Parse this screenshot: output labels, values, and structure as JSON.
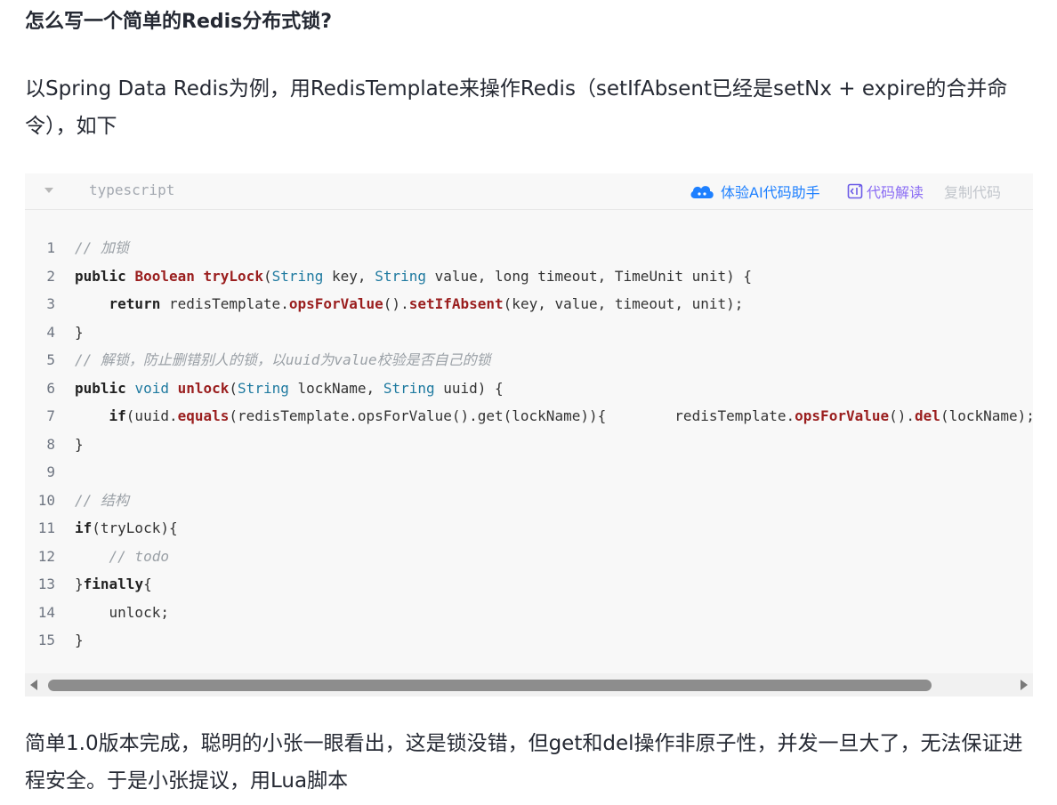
{
  "article": {
    "heading": "怎么写一个简单的Redis分布式锁?",
    "intro": "以Spring Data Redis为例，用RedisTemplate来操作Redis（setIfAbsent已经是setNx + expire的合并命令），如下",
    "followup": "简单1.0版本完成，聪明的小张一眼看出，这是锁没错，但get和del操作非原子性，并发一旦大了，无法保证进程安全。于是小张提议，用Lua脚本"
  },
  "code_block": {
    "language": "typescript",
    "ai_assistant_label": "体验AI代码助手",
    "explain_label": "代码解读",
    "copy_label": "复制代码",
    "scroll_position": 0.0,
    "lines": [
      {
        "n": "1",
        "segments": [
          {
            "t": "// 加锁",
            "c": "cm"
          }
        ]
      },
      {
        "n": "2",
        "segments": [
          {
            "t": "public",
            "c": "kw"
          },
          {
            "t": " "
          },
          {
            "t": "Boolean",
            "c": "cl"
          },
          {
            "t": " "
          },
          {
            "t": "tryLock",
            "c": "fn"
          },
          {
            "t": "("
          },
          {
            "t": "String",
            "c": "ty"
          },
          {
            "t": " key, "
          },
          {
            "t": "String",
            "c": "ty"
          },
          {
            "t": " value, long timeout, TimeUnit unit) {"
          }
        ]
      },
      {
        "n": "3",
        "segments": [
          {
            "t": "    "
          },
          {
            "t": "return",
            "c": "kw"
          },
          {
            "t": " redisTemplate."
          },
          {
            "t": "opsForValue",
            "c": "fn"
          },
          {
            "t": "()."
          },
          {
            "t": "setIfAbsent",
            "c": "fn"
          },
          {
            "t": "(key, value, timeout, unit);"
          }
        ]
      },
      {
        "n": "4",
        "segments": [
          {
            "t": "}"
          }
        ]
      },
      {
        "n": "5",
        "segments": [
          {
            "t": "// 解锁，防止删错别人的锁，以uuid为value校验是否自己的锁",
            "c": "cm"
          }
        ]
      },
      {
        "n": "6",
        "segments": [
          {
            "t": "public",
            "c": "kw"
          },
          {
            "t": " "
          },
          {
            "t": "void",
            "c": "ty"
          },
          {
            "t": " "
          },
          {
            "t": "unlock",
            "c": "fn"
          },
          {
            "t": "("
          },
          {
            "t": "String",
            "c": "ty"
          },
          {
            "t": " lockName, "
          },
          {
            "t": "String",
            "c": "ty"
          },
          {
            "t": " uuid) {"
          }
        ]
      },
      {
        "n": "7",
        "segments": [
          {
            "t": "    "
          },
          {
            "t": "if",
            "c": "kw"
          },
          {
            "t": "(uuid."
          },
          {
            "t": "equals",
            "c": "fn"
          },
          {
            "t": "(redisTemplate.opsForValue().get(lockName)){        redisTemplate."
          },
          {
            "t": "opsForValue",
            "c": "fn"
          },
          {
            "t": "()."
          },
          {
            "t": "del",
            "c": "fn"
          },
          {
            "t": "(lockName); }"
          }
        ]
      },
      {
        "n": "8",
        "segments": [
          {
            "t": "}"
          }
        ]
      },
      {
        "n": "9",
        "segments": [
          {
            "t": ""
          }
        ]
      },
      {
        "n": "10",
        "segments": [
          {
            "t": "// 结构",
            "c": "cm"
          }
        ]
      },
      {
        "n": "11",
        "segments": [
          {
            "t": "if",
            "c": "kw"
          },
          {
            "t": "(tryLock){"
          }
        ]
      },
      {
        "n": "12",
        "segments": [
          {
            "t": "    "
          },
          {
            "t": "// todo",
            "c": "cm"
          }
        ]
      },
      {
        "n": "13",
        "segments": [
          {
            "t": "}"
          },
          {
            "t": "finally",
            "c": "kw"
          },
          {
            "t": "{"
          }
        ]
      },
      {
        "n": "14",
        "segments": [
          {
            "t": "    unlock;"
          }
        ]
      },
      {
        "n": "15",
        "segments": [
          {
            "t": "}"
          }
        ]
      }
    ]
  }
}
